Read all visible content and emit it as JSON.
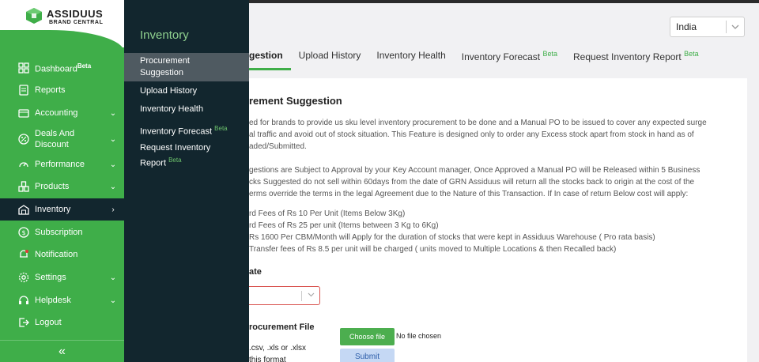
{
  "brand": {
    "name": "ASSIDUUS",
    "sub": "BRAND CENTRAL"
  },
  "sidebar": {
    "items": [
      {
        "label": "Dashboard",
        "badge": "Beta"
      },
      {
        "label": "Reports"
      },
      {
        "label": "Accounting",
        "arrow": "⌄"
      },
      {
        "label": "Deals And Discount",
        "arrow": "⌄"
      },
      {
        "label": "Performance",
        "arrow": "⌄"
      },
      {
        "label": "Products",
        "arrow": "⌄"
      },
      {
        "label": "Inventory",
        "arrow": "›"
      },
      {
        "label": "Subscription"
      },
      {
        "label": "Notification"
      },
      {
        "label": "Settings",
        "arrow": "⌄"
      },
      {
        "label": "Helpdesk",
        "arrow": "⌄"
      },
      {
        "label": "Logout"
      }
    ],
    "collapse_icon": "«"
  },
  "submenu": {
    "title": "Inventory",
    "items": [
      {
        "label": "Procurement Suggestion"
      },
      {
        "label": "Upload History"
      },
      {
        "label": "Inventory Health"
      },
      {
        "label": "Inventory Forecast",
        "badge": "Beta"
      },
      {
        "label": "Request Inventory Report",
        "badge": "Beta"
      }
    ]
  },
  "header": {
    "country": "India"
  },
  "tabs": [
    {
      "label": "gestion"
    },
    {
      "label": "Upload History"
    },
    {
      "label": "Inventory Health"
    },
    {
      "label": "Inventory Forecast",
      "badge": "Beta"
    },
    {
      "label": "Request Inventory Report",
      "badge": "Beta"
    }
  ],
  "content": {
    "heading": "rement Suggestion",
    "p1_l1": "ed for brands to provide us sku level inventory procurement to be done and a Manual PO to be issued to cover any expected surge",
    "p1_l2": "al traffic and avoid out of stock situation. This Feature is designed only to order any Excess stock apart from stock in hand as of",
    "p1_l3": "aded/Submitted.",
    "p2_l1": "gestions are Subject to Approval by your Key Account manager, Once Approved a Manual PO will be Released within 5 Business",
    "p2_l2": "cks Suggested do not sell within 60days from the date of GRN Assiduus will return all the stocks back to origin at the cost of the",
    "p2_l3": "erms override the terms in the legal Agreement due to the Nature of this Transaction. If In case of return Below cost will apply:",
    "fees": [
      "rd Fees of Rs 10 Per Unit (Items Below 3Kg)",
      "rd Fees of Rs 25 per unit (Items between 3 Kg to 6Kg)",
      "Rs 1600 Per CBM/Month will Apply for the duration of stocks that were kept in Assiduus Warehouse ( Pro rata basis)",
      "Transfer fees of Rs 8.5 per unit will be charged ( units moved to Multiple Locations & then Recalled back)"
    ],
    "date_label": "ate",
    "upload_label": "rocurement File",
    "upload_help1": ".csv, .xls or .xlsx",
    "upload_help2": "this format",
    "choose_file": "Choose file",
    "no_file": "No file chosen",
    "submit": "Submit"
  }
}
